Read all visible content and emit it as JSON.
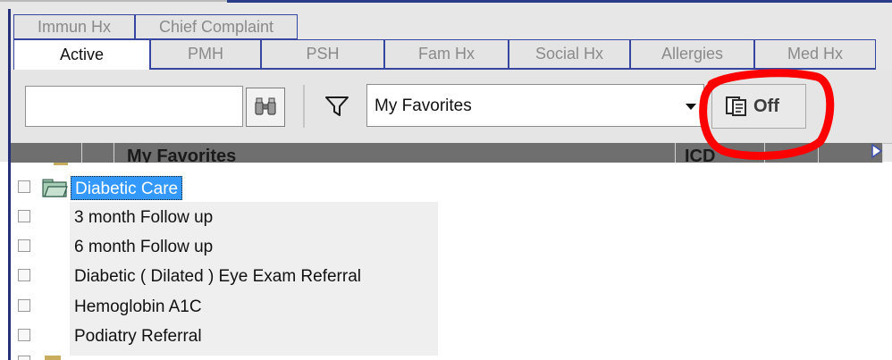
{
  "tabs_row1": [
    {
      "label": "Immun Hx"
    },
    {
      "label": "Chief Complaint"
    }
  ],
  "tabs_row2": [
    {
      "label": "Active",
      "active": true
    },
    {
      "label": "PMH"
    },
    {
      "label": "PSH"
    },
    {
      "label": "Fam Hx"
    },
    {
      "label": "Social Hx"
    },
    {
      "label": "Allergies"
    },
    {
      "label": "Med Hx"
    }
  ],
  "toolbar": {
    "search_value": "",
    "favorites_select": {
      "selected": "My Favorites"
    },
    "off_button_label": "Off"
  },
  "grid_header": {
    "col1": "My Favorites",
    "col2": "ICD"
  },
  "list": {
    "folder": {
      "label": "Diabetic Care",
      "selected": true
    },
    "items": [
      {
        "label": "3 month Follow up"
      },
      {
        "label": "6 month Follow up"
      },
      {
        "label": "Diabetic ( Dilated ) Eye Exam Referral"
      },
      {
        "label": "Hemoglobin A1C"
      },
      {
        "label": "Podiatry Referral"
      }
    ]
  },
  "colors": {
    "tab_border": "#3646a0",
    "selection": "#3399ff",
    "annotation": "#ff0000"
  }
}
